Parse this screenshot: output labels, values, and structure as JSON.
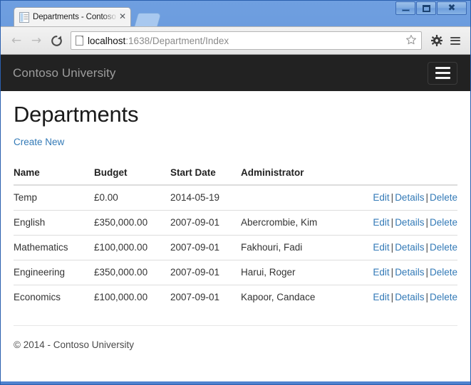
{
  "window": {
    "controls": {
      "minimize": "Minimize",
      "maximize": "Maximize",
      "close": "Close"
    }
  },
  "browser": {
    "tab": {
      "title": "Departments - Contoso University",
      "close_label": "✕",
      "favicon": "document-icon"
    },
    "new_tab_label": "New Tab",
    "toolbar": {
      "back": "←",
      "forward": "→",
      "reload": "⟳",
      "url_host": "localhost",
      "url_rest": ":1638/Department/Index",
      "url_full": "localhost:1638/Department/Index",
      "star": "☆",
      "gear": "⚙",
      "menu": "menu-icon"
    }
  },
  "navbar": {
    "brand": "Contoso University",
    "toggle_label": "Toggle navigation"
  },
  "page": {
    "title": "Departments",
    "create_new_label": "Create New",
    "table": {
      "columns": [
        "Name",
        "Budget",
        "Start Date",
        "Administrator"
      ],
      "rows": [
        {
          "name": "Temp",
          "budget": "£0.00",
          "start_date": "2014-05-19",
          "administrator": "",
          "actions": {
            "edit": "Edit",
            "details": "Details",
            "delete": "Delete"
          }
        },
        {
          "name": "English",
          "budget": "£350,000.00",
          "start_date": "2007-09-01",
          "administrator": "Abercrombie, Kim",
          "actions": {
            "edit": "Edit",
            "details": "Details",
            "delete": "Delete"
          }
        },
        {
          "name": "Mathematics",
          "budget": "£100,000.00",
          "start_date": "2007-09-01",
          "administrator": "Fakhouri, Fadi",
          "actions": {
            "edit": "Edit",
            "details": "Details",
            "delete": "Delete"
          }
        },
        {
          "name": "Engineering",
          "budget": "£350,000.00",
          "start_date": "2007-09-01",
          "administrator": "Harui, Roger",
          "actions": {
            "edit": "Edit",
            "details": "Details",
            "delete": "Delete"
          }
        },
        {
          "name": "Economics",
          "budget": "£100,000.00",
          "start_date": "2007-09-01",
          "administrator": "Kapoor, Candace",
          "actions": {
            "edit": "Edit",
            "details": "Details",
            "delete": "Delete"
          }
        }
      ],
      "separator": "|"
    }
  },
  "footer": {
    "copyright": "© 2014 - Contoso University"
  },
  "colors": {
    "navbar_bg": "#222222",
    "link": "#337ab7",
    "brand_text": "#9d9d9d",
    "window_border": "#2a5fae"
  }
}
